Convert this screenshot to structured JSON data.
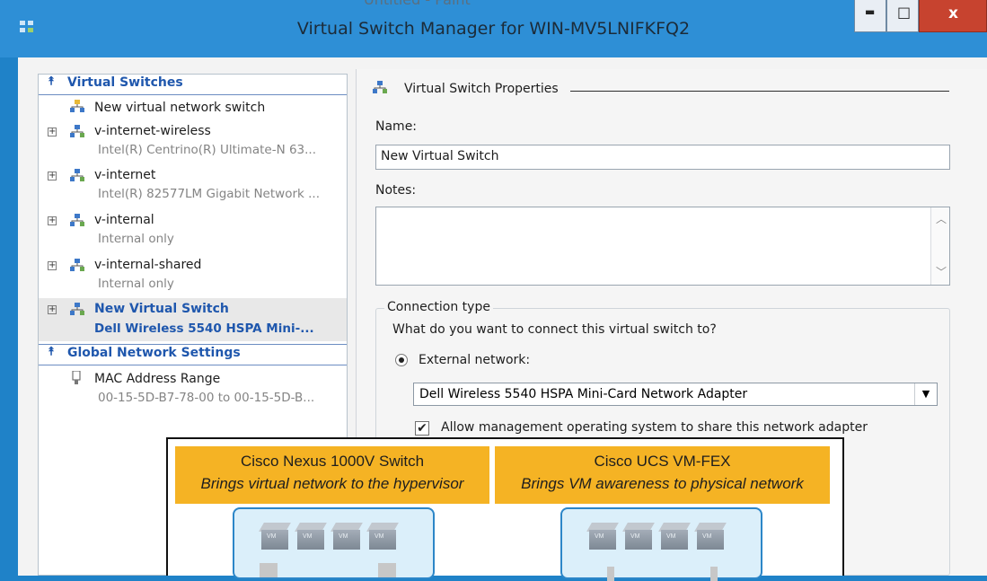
{
  "window": {
    "background_title": "Untitled - Paint",
    "title": "Virtual Switch Manager for WIN-MV5LNIFKFQ2",
    "controls": {
      "minimize": "▬",
      "maximize": "□",
      "close": "x"
    }
  },
  "left_pane": {
    "virtual_switches_header": "Virtual Switches",
    "new_switch": "New virtual network switch",
    "switches": [
      {
        "name": "v-internet-wireless",
        "detail": "Intel(R) Centrino(R) Ultimate-N 63..."
      },
      {
        "name": "v-internet",
        "detail": "Intel(R) 82577LM Gigabit Network ..."
      },
      {
        "name": "v-internal",
        "detail": "Internal only"
      },
      {
        "name": "v-internal-shared",
        "detail": "Internal only"
      },
      {
        "name": "New Virtual Switch",
        "detail": "Dell Wireless 5540 HSPA Mini-...",
        "selected": true
      }
    ],
    "global_header": "Global Network Settings",
    "mac": {
      "name": "MAC Address Range",
      "detail": "00-15-5D-B7-78-00 to 00-15-5D-B..."
    }
  },
  "properties": {
    "header": "Virtual Switch Properties",
    "name_label": "Name:",
    "name_value": "New Virtual Switch",
    "notes_label": "Notes:",
    "connection_type_label": "Connection type",
    "question": "What do you want to connect this virtual switch to?",
    "external_label": "External network:",
    "adapter_selected": "Dell Wireless 5540 HSPA Mini-Card Network Adapter",
    "share_label": "Allow management operating system to share this network adapter"
  },
  "overlay": {
    "left_title": "Cisco Nexus 1000V Switch",
    "left_sub": "Brings virtual network to the hypervisor",
    "right_title": "Cisco UCS VM-FEX",
    "right_sub": "Brings VM awareness to physical network",
    "vm_label": "VM"
  },
  "colors": {
    "titlebar": "#2e8fd6",
    "close": "#c7432f",
    "accent": "#1f57ad",
    "banner": "#f5b324"
  }
}
